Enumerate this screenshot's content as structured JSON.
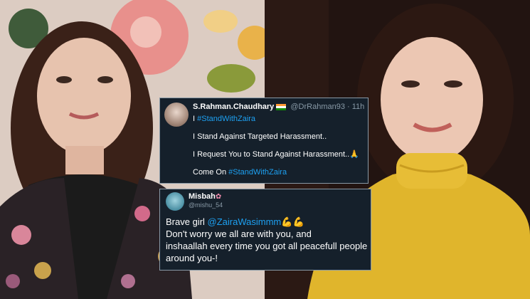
{
  "tweets": [
    {
      "name": "S.Rahman.Chaudhary",
      "handle": "@DrRahman93",
      "time": "· 11h",
      "line1_prefix": "I",
      "line1_tag": "#StandWithZaira",
      "line2": "I Stand Against Targeted Harassment..",
      "line3_text": "I Request You to Stand Against Harassment..",
      "line3_emoji": "🙏",
      "line4_prefix": "Come On",
      "line4_tag": "#StandWithZaira"
    },
    {
      "name": "Misbah",
      "handle": "@mishu_54",
      "body_prefix": "Brave girl",
      "mention": "@ZairaWasimmm",
      "emoji": "💪💪",
      "line2": "Don't worry we all are with you, and",
      "line3": "inshaallah every time you got all peacefull people",
      "line4": "around you-!"
    }
  ]
}
